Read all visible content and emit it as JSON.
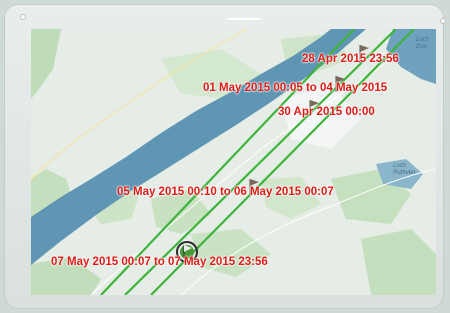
{
  "map": {
    "route_color": "#3db43c",
    "label_color": "#dd1b16",
    "water_color": "#5e96b4",
    "markers": [
      {
        "label": "28 Apr 2015 23:56",
        "icon": "flag-marker-icon"
      },
      {
        "label": "01 May 2015 00:05 to 04 May 2015",
        "icon": "flag-marker-icon"
      },
      {
        "label": "30 Apr 2015 00:00",
        "icon": "flag-marker-icon"
      },
      {
        "label": "05 May 2015 00:10 to 06 May 2015 00:07",
        "icon": "flag-marker-icon"
      },
      {
        "label": "07 May 2015 00:07 to 07 May 2015 23:56",
        "icon": "flag-marker-icon"
      }
    ],
    "place_labels": [
      "Loch",
      "Dun",
      "Loch Ruthven"
    ]
  }
}
